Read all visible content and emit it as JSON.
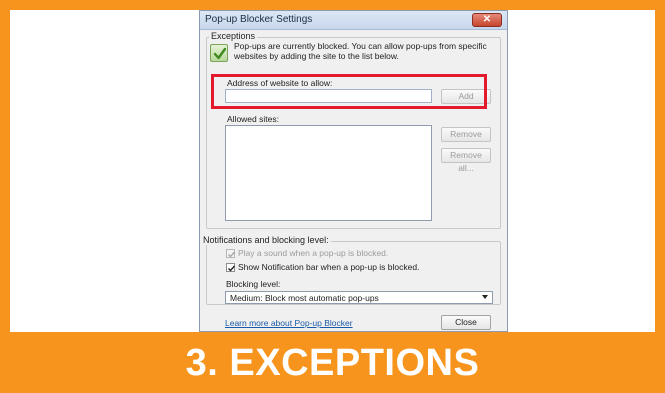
{
  "dialog": {
    "title": "Pop-up Blocker Settings",
    "close_symbol": "✕"
  },
  "exceptions": {
    "group_label": "Exceptions",
    "icon": "check-shield-icon",
    "description_line1": "Pop-ups are currently blocked.  You can allow pop-ups from specific",
    "description_line2": "websites by adding the site to the list below.",
    "address_label": "Address of website to allow:",
    "address_value": "",
    "add_button": "Add",
    "allowed_label": "Allowed sites:",
    "remove_button": "Remove",
    "remove_all_button": "Remove all..."
  },
  "notifications": {
    "group_label": "Notifications and blocking level:",
    "play_sound_label": "Play a sound when a pop-up is blocked.",
    "play_sound_checked": true,
    "show_bar_label": "Show Notification bar when a pop-up is blocked.",
    "show_bar_checked": true,
    "blocking_level_label": "Blocking level:",
    "blocking_level_value": "Medium: Block most automatic pop-ups"
  },
  "footer": {
    "learn_more_link": "Learn more about Pop-up Blocker",
    "close_button": "Close"
  },
  "caption": "3. EXCEPTIONS",
  "colors": {
    "accent_orange": "#f7941d",
    "highlight_red": "#e21a2c"
  }
}
